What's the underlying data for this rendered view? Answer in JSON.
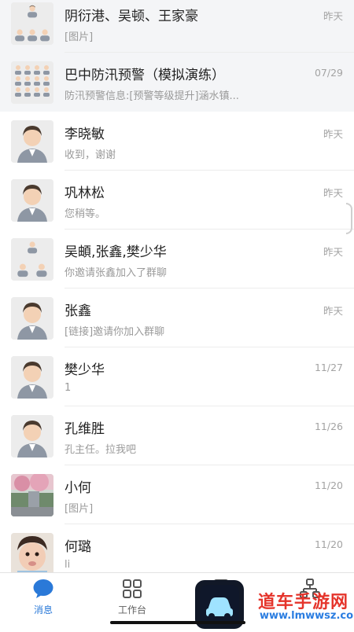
{
  "chats": [
    {
      "name": "阴衍港、吴顿、王家豪",
      "preview": "[图片]",
      "time": "昨天",
      "avatar": "group-avatar",
      "pinned": true
    },
    {
      "name": "巴中防汛预警（模拟演练）",
      "preview": "防汛预警信息:[预警等级提升]涵水镇...",
      "time": "07/29",
      "avatar": "group-avatar-large",
      "pinned": true
    },
    {
      "name": "李晓敏",
      "preview": "收到，谢谢",
      "time": "昨天",
      "avatar": "person-avatar",
      "pinned": false
    },
    {
      "name": "巩林松",
      "preview": "您稍等。",
      "time": "昨天",
      "avatar": "person-avatar",
      "pinned": false
    },
    {
      "name": "吴頔,张鑫,樊少华",
      "preview": "你邀请张鑫加入了群聊",
      "time": "昨天",
      "avatar": "group-avatar",
      "pinned": false
    },
    {
      "name": "张鑫",
      "preview": "[链接]邀请你加入群聊",
      "time": "昨天",
      "avatar": "person-avatar",
      "pinned": false
    },
    {
      "name": "樊少华",
      "preview": "1",
      "time": "11/27",
      "avatar": "person-avatar",
      "pinned": false
    },
    {
      "name": "孔维胜",
      "preview": "孔主任。拉我吧",
      "time": "11/26",
      "avatar": "person-avatar",
      "pinned": false
    },
    {
      "name": "小何",
      "preview": "[图片]",
      "time": "11/20",
      "avatar": "photo-avatar",
      "pinned": false
    },
    {
      "name": "何璐",
      "preview": "li",
      "time": "11/20",
      "avatar": "baby-avatar",
      "pinned": false
    }
  ],
  "tabs": [
    {
      "label": "消息",
      "icon": "chat-bubble-icon",
      "active": true
    },
    {
      "label": "工作台",
      "icon": "grid-icon",
      "active": false
    },
    {
      "label": "",
      "icon": "contacts-icon",
      "active": false
    },
    {
      "label": "",
      "icon": "org-icon",
      "active": false
    }
  ],
  "watermark": {
    "title": "道车手游网",
    "url": "www.lmwwsz.com"
  },
  "colors": {
    "accent": "#2a79d8",
    "pinned_bg": "#f4f5f7"
  }
}
